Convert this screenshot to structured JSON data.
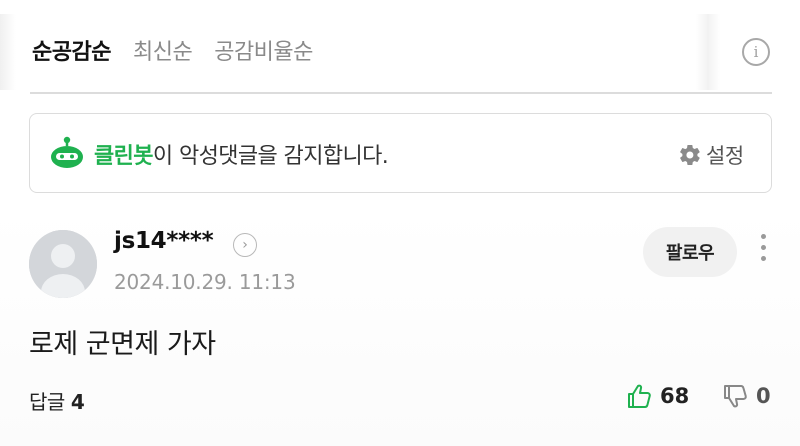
{
  "sort_tabs": [
    {
      "label": "순공감순",
      "active": true
    },
    {
      "label": "최신순",
      "active": false
    },
    {
      "label": "공감비율순",
      "active": false
    }
  ],
  "info_icon": {
    "icon": "info-icon",
    "glyph": "i"
  },
  "clean_bot": {
    "name": "클린봇",
    "description": "이 악성댓글을 감지합니다.",
    "settings_label": "설정",
    "accent_color": "#1fb14f"
  },
  "comment": {
    "username": "js14****",
    "timestamp": "2024.10.29. 11:13",
    "follow_label": "팔로우",
    "text": "로제 군면제 가자",
    "reply_label": "답글",
    "reply_count": "4",
    "like_count": "68",
    "dislike_count": "0",
    "like_color": "#1fb14f"
  }
}
